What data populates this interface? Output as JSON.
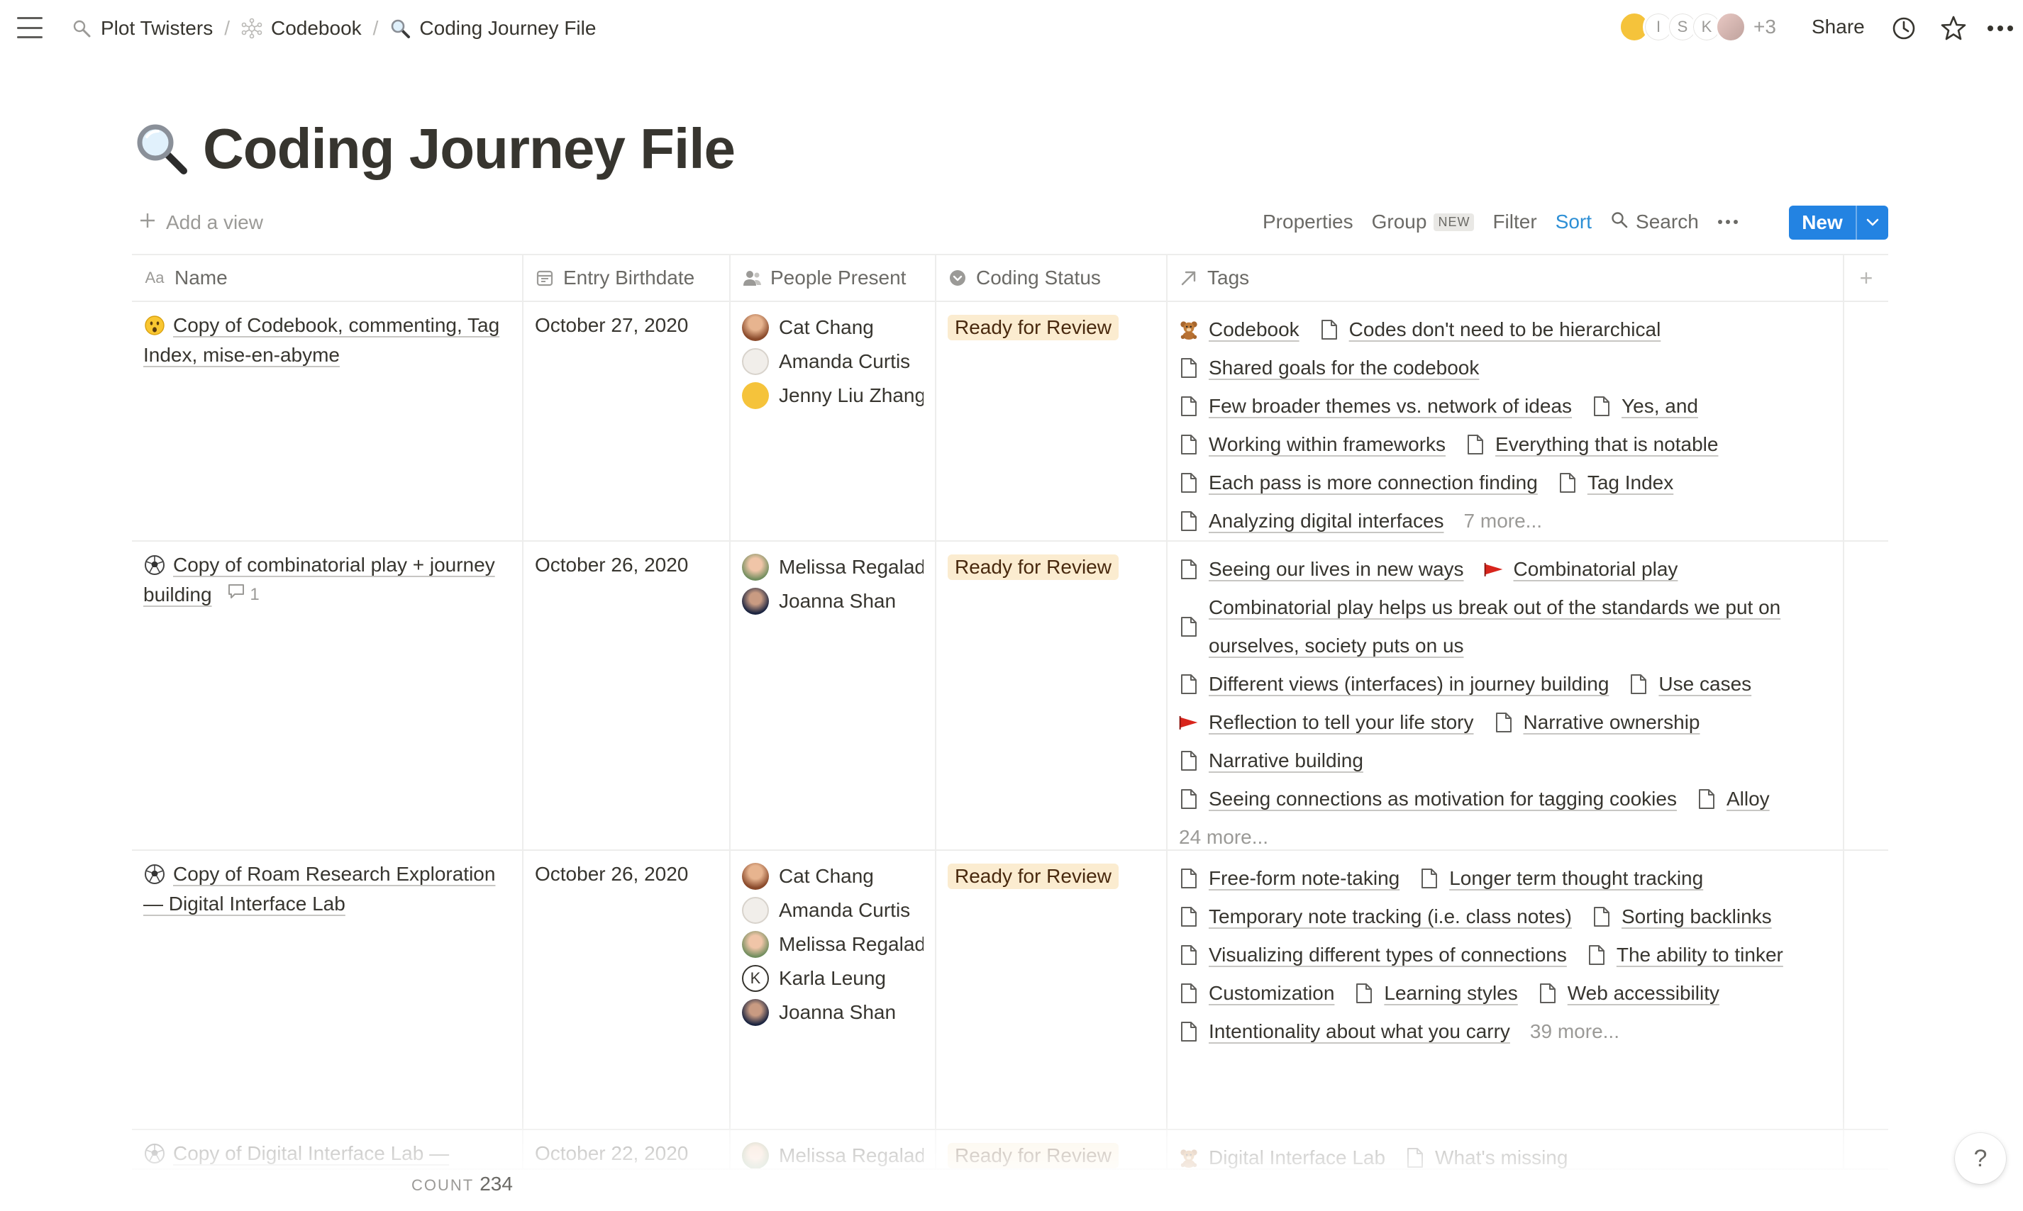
{
  "breadcrumb": [
    {
      "label": "Plot Twisters",
      "icon": "magnifier-icon"
    },
    {
      "label": "Codebook",
      "icon": "network-icon"
    },
    {
      "label": "Coding Journey File",
      "icon": "magnifier-icon"
    }
  ],
  "breadcrumb_sep": "/",
  "topbar": {
    "avatar_letters": [
      "I",
      "S",
      "K"
    ],
    "extra_count": "+3",
    "share_label": "Share"
  },
  "page": {
    "title": "Coding Journey File",
    "title_icon": "magnifier-icon"
  },
  "view": {
    "add_view_label": "Add a view"
  },
  "toolbar": {
    "properties": "Properties",
    "group": "Group",
    "group_badge": "NEW",
    "filter": "Filter",
    "sort": "Sort",
    "search": "Search",
    "new_label": "New"
  },
  "columns": {
    "name": "Name",
    "date": "Entry Birthdate",
    "people": "People Present",
    "status": "Coding Status",
    "tags": "Tags",
    "add": "+"
  },
  "rows": [
    {
      "name": "Copy of Codebook, commenting, Tag Index, mise-en-abyme",
      "icon": "surprised-face-icon",
      "date": "October 27, 2020",
      "people": [
        {
          "name": "Cat Chang",
          "avatar": "cat"
        },
        {
          "name": "Amanda Curtis",
          "avatar": "amanda"
        },
        {
          "name": "Jenny Liu Zhang",
          "avatar": "jenny"
        }
      ],
      "status": "Ready for Review",
      "tags": [
        {
          "label": "Codebook",
          "icon": "teddy-bear-icon"
        },
        {
          "label": "Codes don't need to be hierarchical",
          "icon": "page-icon"
        },
        {
          "label": "Shared goals for the codebook",
          "icon": "page-icon"
        },
        {
          "label": "Few broader themes vs. network of ideas",
          "icon": "page-icon"
        },
        {
          "label": "Yes, and",
          "icon": "page-icon"
        },
        {
          "label": "Working within frameworks",
          "icon": "page-icon"
        },
        {
          "label": "Everything that is notable",
          "icon": "page-icon"
        },
        {
          "label": "Each pass is more connection finding",
          "icon": "page-icon"
        },
        {
          "label": "Tag Index",
          "icon": "page-icon"
        },
        {
          "label": "Analyzing digital interfaces",
          "icon": "page-icon"
        }
      ],
      "more": "7 more..."
    },
    {
      "name": "Copy of combinatorial play + journey building",
      "icon": "soccer-ball-icon",
      "comment_count": "1",
      "date": "October 26, 2020",
      "people": [
        {
          "name": "Melissa Regalado",
          "avatar": "melissa"
        },
        {
          "name": "Joanna Shan",
          "avatar": "joanna"
        }
      ],
      "status": "Ready for Review",
      "tags": [
        {
          "label": "Seeing our lives in new ways",
          "icon": "page-icon"
        },
        {
          "label": "Combinatorial play",
          "icon": "red-flag-icon"
        },
        {
          "label": "Combinatorial play helps us break out of the standards we put on ourselves, society puts on us",
          "icon": "page-icon"
        },
        {
          "label": "Different views (interfaces) in journey building",
          "icon": "page-icon"
        },
        {
          "label": "Use cases",
          "icon": "page-icon"
        },
        {
          "label": "Reflection to tell your life story",
          "icon": "red-flag-icon"
        },
        {
          "label": "Narrative ownership",
          "icon": "page-icon"
        },
        {
          "label": "Narrative building",
          "icon": "page-icon"
        },
        {
          "label": "Seeing connections as motivation for tagging cookies",
          "icon": "page-icon"
        },
        {
          "label": "Alloy",
          "icon": "page-icon"
        }
      ],
      "more": "24 more..."
    },
    {
      "name": "Copy of Roam Research Exploration — Digital Interface Lab",
      "icon": "soccer-ball-icon",
      "date": "October 26, 2020",
      "people": [
        {
          "name": "Cat Chang",
          "avatar": "cat"
        },
        {
          "name": "Amanda Curtis",
          "avatar": "amanda"
        },
        {
          "name": "Melissa Regalado",
          "avatar": "melissa"
        },
        {
          "name": "Karla Leung",
          "avatar": "karla",
          "letter": "K"
        },
        {
          "name": "Joanna Shan",
          "avatar": "joanna"
        }
      ],
      "status": "Ready for Review",
      "tags": [
        {
          "label": "Free-form note-taking",
          "icon": "page-icon"
        },
        {
          "label": "Longer term thought tracking",
          "icon": "page-icon"
        },
        {
          "label": "Temporary note tracking (i.e. class notes)",
          "icon": "page-icon"
        },
        {
          "label": "Sorting backlinks",
          "icon": "page-icon"
        },
        {
          "label": "Visualizing different types of connections",
          "icon": "page-icon"
        },
        {
          "label": "The ability to tinker",
          "icon": "page-icon"
        },
        {
          "label": "Customization",
          "icon": "page-icon"
        },
        {
          "label": "Learning styles",
          "icon": "page-icon"
        },
        {
          "label": "Web accessibility",
          "icon": "page-icon"
        },
        {
          "label": "Intentionality about what you carry",
          "icon": "page-icon"
        }
      ],
      "more": "39 more..."
    },
    {
      "name": "Copy of Digital Interface Lab —",
      "icon": "soccer-ball-icon",
      "date": "October 22, 2020",
      "people": [
        {
          "name": "Melissa Regalado",
          "avatar": "melissa"
        }
      ],
      "status": "Ready for Review",
      "tags": [
        {
          "label": "Digital Interface Lab",
          "icon": "teddy-bear-icon"
        },
        {
          "label": "What's missing",
          "icon": "page-icon"
        }
      ],
      "more": ""
    }
  ],
  "footer": {
    "count_label": "COUNT",
    "count_value": "234"
  },
  "help": {
    "label": "?"
  }
}
